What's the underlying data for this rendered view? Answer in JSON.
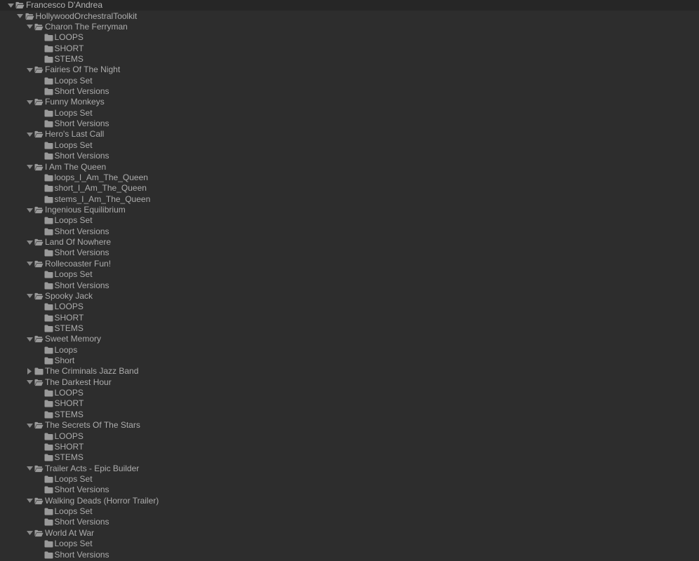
{
  "tree": [
    {
      "label": "Francesco D'Andrea",
      "level": 0,
      "expandable": true,
      "expanded": true
    },
    {
      "label": "HollywoodOrchestralToolkit",
      "level": 1,
      "expandable": true,
      "expanded": true
    },
    {
      "label": "Charon The Ferryman",
      "level": 2,
      "expandable": true,
      "expanded": true
    },
    {
      "label": "LOOPS",
      "level": 3,
      "expandable": false
    },
    {
      "label": "SHORT",
      "level": 3,
      "expandable": false
    },
    {
      "label": "STEMS",
      "level": 3,
      "expandable": false
    },
    {
      "label": "Fairies Of The Night",
      "level": 2,
      "expandable": true,
      "expanded": true
    },
    {
      "label": "Loops Set",
      "level": 3,
      "expandable": false
    },
    {
      "label": "Short Versions",
      "level": 3,
      "expandable": false
    },
    {
      "label": "Funny Monkeys",
      "level": 2,
      "expandable": true,
      "expanded": true
    },
    {
      "label": "Loops Set",
      "level": 3,
      "expandable": false
    },
    {
      "label": "Short Versions",
      "level": 3,
      "expandable": false
    },
    {
      "label": "Hero's Last Call",
      "level": 2,
      "expandable": true,
      "expanded": true
    },
    {
      "label": "Loops Set",
      "level": 3,
      "expandable": false
    },
    {
      "label": "Short Versions",
      "level": 3,
      "expandable": false
    },
    {
      "label": "I Am The Queen",
      "level": 2,
      "expandable": true,
      "expanded": true
    },
    {
      "label": "loops_I_Am_The_Queen",
      "level": 3,
      "expandable": false
    },
    {
      "label": "short_I_Am_The_Queen",
      "level": 3,
      "expandable": false
    },
    {
      "label": "stems_I_Am_The_Queen",
      "level": 3,
      "expandable": false
    },
    {
      "label": "Ingenious Equilibrium",
      "level": 2,
      "expandable": true,
      "expanded": true
    },
    {
      "label": "Loops Set",
      "level": 3,
      "expandable": false
    },
    {
      "label": "Short Versions",
      "level": 3,
      "expandable": false
    },
    {
      "label": "Land Of Nowhere",
      "level": 2,
      "expandable": true,
      "expanded": true
    },
    {
      "label": "Short Versions",
      "level": 3,
      "expandable": false
    },
    {
      "label": "Rollecoaster Fun!",
      "level": 2,
      "expandable": true,
      "expanded": true
    },
    {
      "label": "Loops Set",
      "level": 3,
      "expandable": false
    },
    {
      "label": "Short Versions",
      "level": 3,
      "expandable": false
    },
    {
      "label": "Spooky Jack",
      "level": 2,
      "expandable": true,
      "expanded": true
    },
    {
      "label": "LOOPS",
      "level": 3,
      "expandable": false
    },
    {
      "label": "SHORT",
      "level": 3,
      "expandable": false
    },
    {
      "label": "STEMS",
      "level": 3,
      "expandable": false
    },
    {
      "label": "Sweet Memory",
      "level": 2,
      "expandable": true,
      "expanded": true
    },
    {
      "label": "Loops",
      "level": 3,
      "expandable": false
    },
    {
      "label": "Short",
      "level": 3,
      "expandable": false
    },
    {
      "label": "The Criminals Jazz Band",
      "level": 2,
      "expandable": true,
      "expanded": false
    },
    {
      "label": "The Darkest Hour",
      "level": 2,
      "expandable": true,
      "expanded": true
    },
    {
      "label": "LOOPS",
      "level": 3,
      "expandable": false
    },
    {
      "label": "SHORT",
      "level": 3,
      "expandable": false
    },
    {
      "label": "STEMS",
      "level": 3,
      "expandable": false
    },
    {
      "label": "The Secrets Of The Stars",
      "level": 2,
      "expandable": true,
      "expanded": true
    },
    {
      "label": "LOOPS",
      "level": 3,
      "expandable": false
    },
    {
      "label": "SHORT",
      "level": 3,
      "expandable": false
    },
    {
      "label": "STEMS",
      "level": 3,
      "expandable": false
    },
    {
      "label": "Trailer Acts - Epic Builder",
      "level": 2,
      "expandable": true,
      "expanded": true
    },
    {
      "label": "Loops Set",
      "level": 3,
      "expandable": false
    },
    {
      "label": "Short Versions",
      "level": 3,
      "expandable": false
    },
    {
      "label": "Walking Deads (Horror Trailer)",
      "level": 2,
      "expandable": true,
      "expanded": true
    },
    {
      "label": "Loops Set",
      "level": 3,
      "expandable": false
    },
    {
      "label": "Short Versions",
      "level": 3,
      "expandable": false
    },
    {
      "label": "World At War",
      "level": 2,
      "expandable": true,
      "expanded": true
    },
    {
      "label": "Loops Set",
      "level": 3,
      "expandable": false
    },
    {
      "label": "Short Versions",
      "level": 3,
      "expandable": false
    }
  ],
  "colors": {
    "background": "#2d2d2d",
    "root_row_background": "#262626",
    "text": "#adadad",
    "icon": "#9a9a9a"
  },
  "icons": {
    "expanded": "triangle-down-icon",
    "collapsed": "triangle-right-icon",
    "folder_open": "folder-open-icon",
    "folder_closed": "folder-icon"
  }
}
